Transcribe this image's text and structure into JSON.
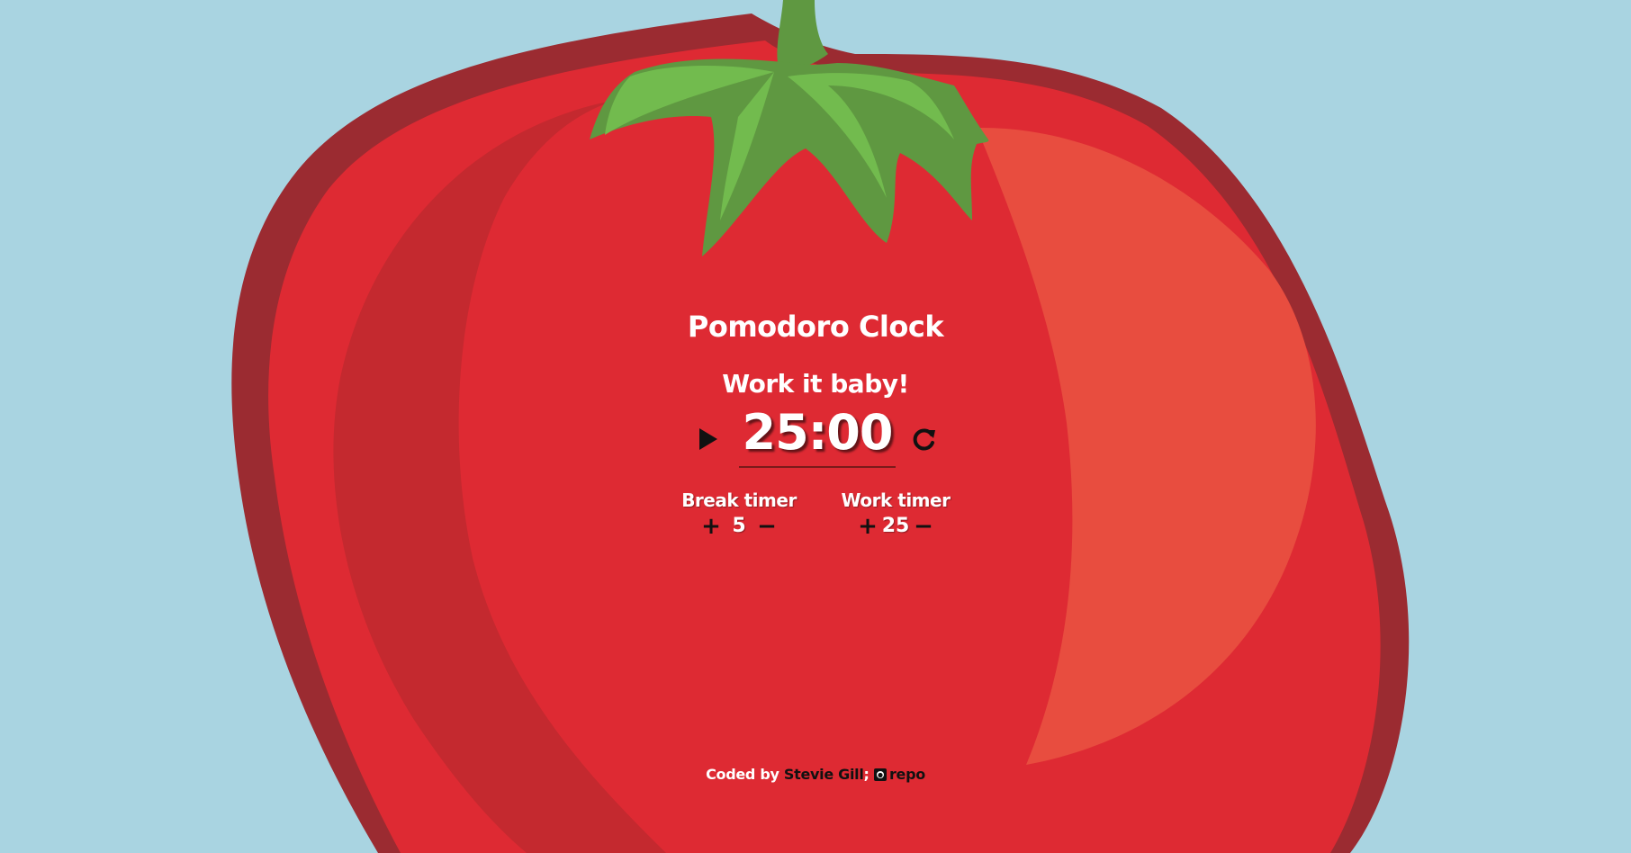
{
  "app": {
    "title": "Pomodoro Clock",
    "status": "Work it baby!",
    "time": "25:00"
  },
  "controls": {
    "play_icon": "play-icon",
    "reset_icon": "reset-icon"
  },
  "break_timer": {
    "label": "Break timer",
    "increment": "+",
    "value": "5",
    "decrement": "−"
  },
  "work_timer": {
    "label": "Work timer",
    "increment": "+",
    "value": "25",
    "decrement": "−"
  },
  "footer": {
    "coded_by": "Coded by",
    "author": "Stevie Gill",
    "separator": ";",
    "repo_icon": "github-icon",
    "repo": "repo"
  },
  "colors": {
    "background": "#a9d4e1",
    "tomato_outline": "#9b2b31",
    "tomato_main": "#de2a33",
    "tomato_shadow": "#c4292f",
    "tomato_highlight": "#e84d3f",
    "stem_dark": "#5f9841",
    "stem_light": "#72bb4e"
  }
}
